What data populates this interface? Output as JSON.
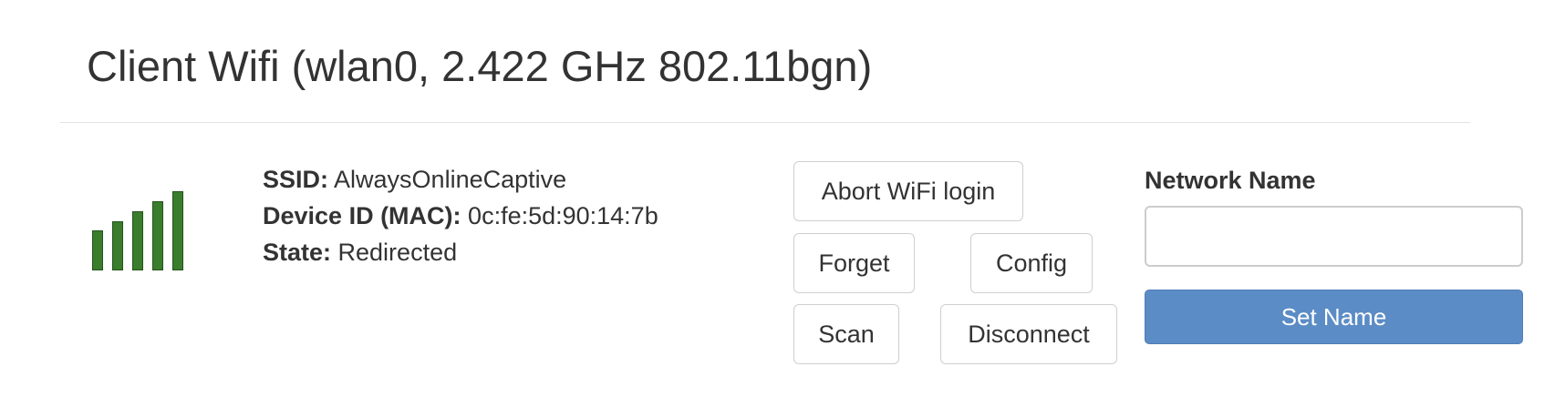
{
  "header": {
    "title": "Client Wifi (wlan0, 2.422 GHz 802.11bgn)"
  },
  "signal": {
    "icon": "signal-strength-icon",
    "bars_total": 5,
    "bars_filled": 5,
    "color": "#3a7d2c"
  },
  "info": {
    "ssid_label": "SSID:",
    "ssid_value": "AlwaysOnlineCaptive",
    "mac_label": "Device ID (MAC):",
    "mac_value": "0c:fe:5d:90:14:7b",
    "state_label": "State:",
    "state_value": "Redirected"
  },
  "actions": {
    "abort_login": "Abort WiFi login",
    "forget": "Forget",
    "config": "Config",
    "scan": "Scan",
    "disconnect": "Disconnect"
  },
  "network_name": {
    "label": "Network Name",
    "value": "",
    "placeholder": "",
    "submit": "Set Name",
    "submit_color": "#5b8cc6"
  }
}
